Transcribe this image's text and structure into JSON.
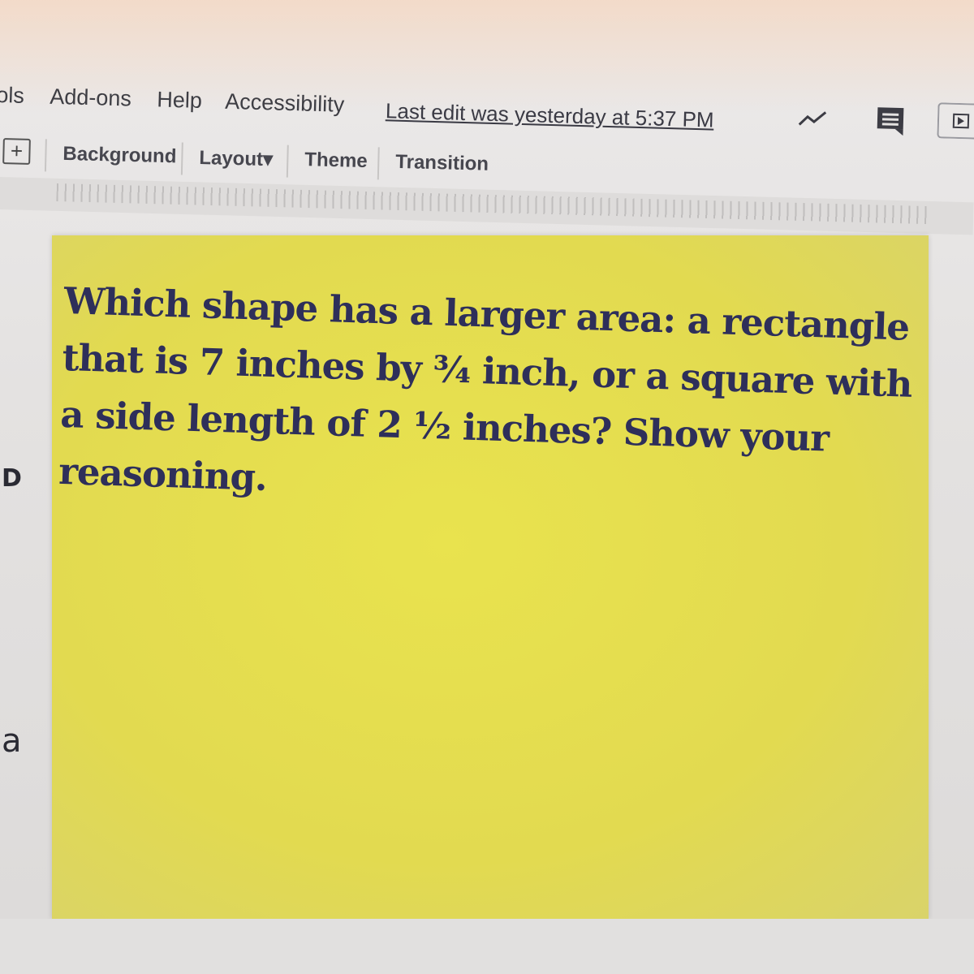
{
  "menu": {
    "items": [
      "ols",
      "Add-ons",
      "Help",
      "Accessibility"
    ],
    "last_edit": "Last edit was yesterday at 5:37 PM"
  },
  "toolbar": {
    "background": "Background",
    "layout": "Layout",
    "layout_caret": "▾",
    "theme": "Theme",
    "transition": "Transition"
  },
  "icons": {
    "activity": "activity-icon",
    "comments": "comments-icon",
    "present": "present-icon",
    "add": "add-icon"
  },
  "slide": {
    "question": "Which shape has a larger area: a rectangle that is 7 inches by ¾ inch, or a square with a side length of 2 ½ inches? Show your reasoning.",
    "background_color": "#e6e04e",
    "text_color": "#2e2f5a"
  },
  "side_marks": {
    "mark1": "D",
    "mark2": "a"
  }
}
